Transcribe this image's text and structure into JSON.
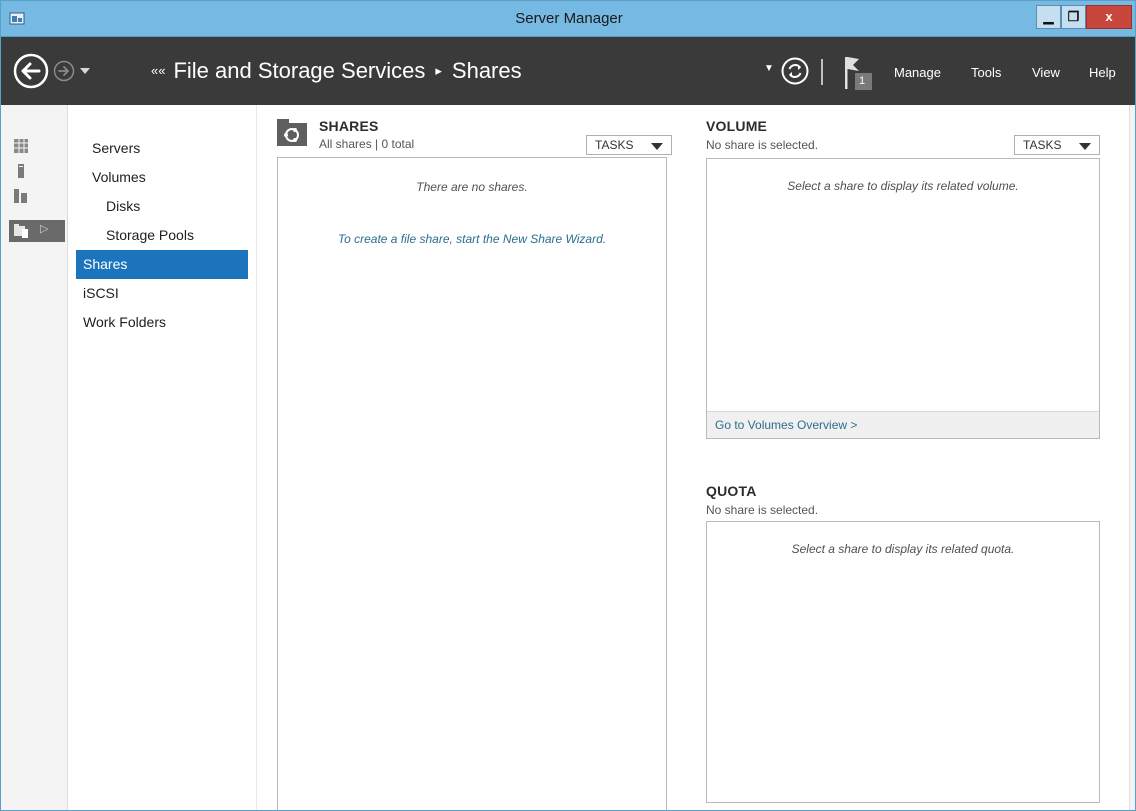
{
  "window": {
    "title": "Server Manager"
  },
  "window_controls": {
    "minimize": "▁",
    "restore": "❐",
    "close": "x"
  },
  "header": {
    "breadcrumb": {
      "prefix": "««",
      "root": "File and Storage Services",
      "separator": "▸",
      "current": "Shares"
    },
    "notification_count": "1",
    "menu": [
      "Manage",
      "Tools",
      "View",
      "Help"
    ]
  },
  "nav": {
    "items": [
      {
        "label": "Servers",
        "level": 0
      },
      {
        "label": "Volumes",
        "level": 0
      },
      {
        "label": "Disks",
        "level": 1
      },
      {
        "label": "Storage Pools",
        "level": 1
      },
      {
        "label": "Shares",
        "level": 0,
        "selected": true
      },
      {
        "label": "iSCSI",
        "level": 0
      },
      {
        "label": "Work Folders",
        "level": 0
      }
    ]
  },
  "shares": {
    "title": "SHARES",
    "subtitle": "All shares | 0 total",
    "tasks": "TASKS",
    "empty_message": "There are no shares.",
    "wizard_link": "To create a file share, start the New Share Wizard."
  },
  "volume": {
    "title": "VOLUME",
    "subtitle": "No share is selected.",
    "tasks": "TASKS",
    "message": "Select a share to display its related volume.",
    "footer_link": "Go to Volumes Overview >"
  },
  "quota": {
    "title": "QUOTA",
    "subtitle": "No share is selected.",
    "message": "Select a share to display its related quota."
  },
  "colors": {
    "titlebar": "#76b9e3",
    "header": "#3a3a3a",
    "selection": "#1c75bc",
    "link": "#2b6e8f"
  }
}
